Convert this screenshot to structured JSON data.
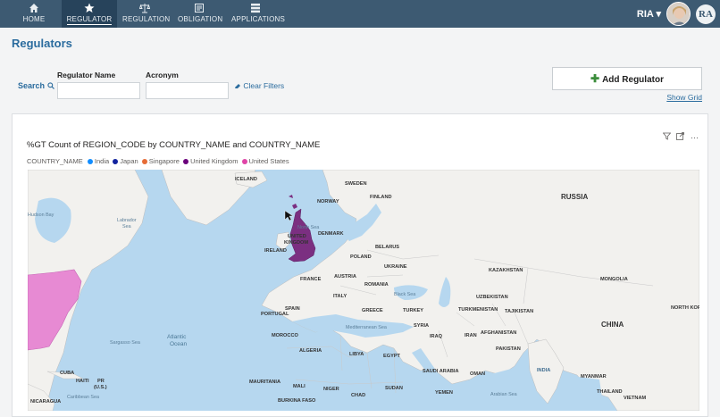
{
  "nav": {
    "items": [
      {
        "label": "HOME",
        "icon": "home-icon"
      },
      {
        "label": "REGULATOR",
        "icon": "star-icon",
        "active": true
      },
      {
        "label": "REGULATION",
        "icon": "scale-icon"
      },
      {
        "label": "OBLIGATION",
        "icon": "document-icon"
      },
      {
        "label": "APPLICATIONS",
        "icon": "grid-icon"
      }
    ],
    "user_name": "RIA",
    "logo_text": "RA"
  },
  "page": {
    "title": "Regulators",
    "search_label": "Search",
    "regulator_name_label": "Regulator Name",
    "regulator_name_value": "",
    "acronym_label": "Acronym",
    "acronym_value": "",
    "clear_filters_label": "Clear Filters",
    "add_regulator_label": "Add Regulator",
    "show_grid_label": "Show Grid"
  },
  "chart": {
    "title": "%GT Count of REGION_CODE by COUNTRY_NAME and COUNTRY_NAME",
    "legend_title": "COUNTRY_NAME",
    "legend": [
      {
        "label": "India",
        "color": "#118dff"
      },
      {
        "label": "Japan",
        "color": "#12239e"
      },
      {
        "label": "Singapore",
        "color": "#e66c37"
      },
      {
        "label": "United Kingdom",
        "color": "#6b007b"
      },
      {
        "label": "United States",
        "color": "#e044a7"
      }
    ]
  },
  "map": {
    "countries": [
      "ICELAND",
      "SWEDEN",
      "NORWAY",
      "FINLAND",
      "RUSSIA",
      "UNITED KINGDOM",
      "IRELAND",
      "DENMARK",
      "BELARUS",
      "POLAND",
      "UKRAINE",
      "FRANCE",
      "AUSTRIA",
      "ROMANIA",
      "KAZAKHSTAN",
      "MONGOLIA",
      "ITALY",
      "UZBEKISTAN",
      "TURKMENISTAN",
      "TAJIKISTAN",
      "PORTUGAL",
      "SPAIN",
      "GREECE",
      "TURKEY",
      "CHINA",
      "NORTH KOREA",
      "SYRIA",
      "IRAQ",
      "IRAN",
      "AFGHANISTAN",
      "MOROCCO",
      "PAKISTAN",
      "ALGERIA",
      "LIBYA",
      "EGYPT",
      "INDIA",
      "SAUDI ARABIA",
      "OMAN",
      "MYANMAR",
      "MAURITANIA",
      "MALI",
      "NIGER",
      "SUDAN",
      "YEMEN",
      "CHAD",
      "THAILAND",
      "VIETNAM",
      "BURKINA FASO",
      "CUBA",
      "HAITI",
      "PR (U.S.)",
      "NICARAGUA"
    ],
    "seas": [
      "North Sea",
      "Black Sea",
      "Mediterranean Sea",
      "Arabian Sea",
      "Labrador Sea",
      "Sargasso Sea",
      "Caribbean Sea",
      "Hudson Bay"
    ],
    "ocean": "Atlantic Ocean"
  }
}
